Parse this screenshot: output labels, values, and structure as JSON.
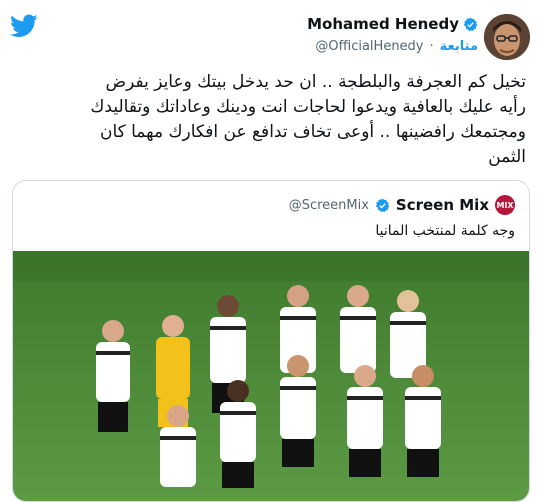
{
  "tweet": {
    "author_name": "Mohamed Henedy",
    "handle": "@OfficialHenedy",
    "follow_label": "متابعة",
    "body_lines": [
      "تخيل كم العجرفة والبلطجة .. ان حد يدخل بيتك وعايز يفرض",
      "رأيه عليك بالعافية ويدعوا لحاجات انت ودينك وعاداتك وتقاليدك",
      "ومجتمعك رافضينها .. أوعى تخاف تدافع عن افكارك مهما كان",
      "الثمن"
    ]
  },
  "quote": {
    "author_name": "Screen Mix",
    "handle": "@ScreenMix",
    "avatar_text": "MIX",
    "text": "وجه كلمة لمنتخب المانيا"
  },
  "colors": {
    "brand_blue": "#1d9bf0",
    "pitch_green": "#4e8a3a",
    "quote_avatar": "#b5163b"
  },
  "icons": [
    "twitter-bird-icon",
    "verified-badge-icon"
  ]
}
